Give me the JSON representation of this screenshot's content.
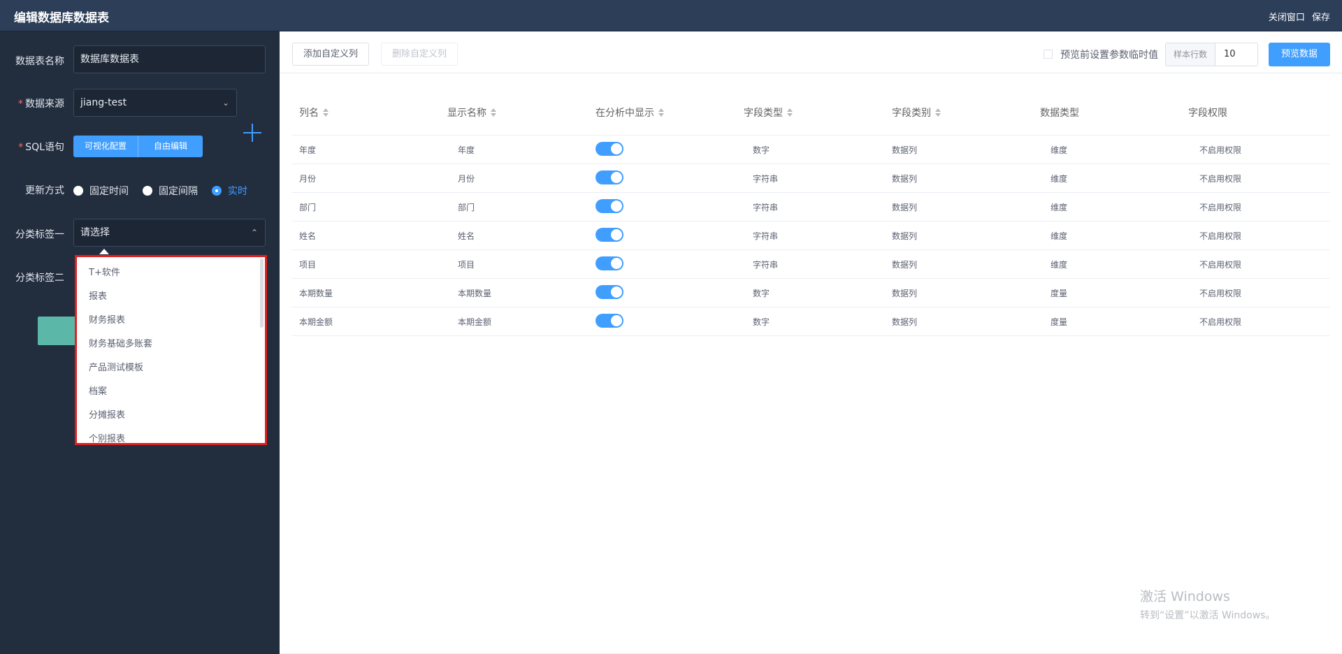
{
  "header": {
    "title": "编辑数据库数据表",
    "close_label": "关闭窗口",
    "save_label": "保存"
  },
  "form": {
    "table_name_label": "数据表名称",
    "table_name_value": "数据库数据表",
    "source_label": "数据来源",
    "source_value": "jiang-test",
    "sql_label": "SQL语句",
    "sql_modes": [
      "可视化配置",
      "自由编辑"
    ],
    "update_label": "更新方式",
    "update_options": [
      "固定时间",
      "固定间隔",
      "实时"
    ],
    "update_selected": "实时",
    "category1_label": "分类标签一",
    "category1_placeholder": "请选择",
    "category2_label": "分类标签二"
  },
  "dropdown": {
    "items": [
      "T+软件",
      "报表",
      "财务报表",
      "财务基础多账套",
      "产品测试模板",
      "档案",
      "分摊报表",
      "个别报表"
    ]
  },
  "toolbar": {
    "add_label": "添加自定义列",
    "delete_label": "删除自定义列",
    "preview_param_label": "预览前设置参数临时值",
    "sample_rows_label": "样本行数",
    "sample_rows_value": "10",
    "preview_label": "预览数据"
  },
  "table": {
    "headers": [
      "列名",
      "显示名称",
      "在分析中显示",
      "字段类型",
      "字段类别",
      "数据类型",
      "字段权限"
    ],
    "rows": [
      [
        "年度",
        "年度",
        "",
        "数字",
        "数据列",
        "维度",
        "不启用权限"
      ],
      [
        "月份",
        "月份",
        "",
        "字符串",
        "数据列",
        "维度",
        "不启用权限"
      ],
      [
        "部门",
        "部门",
        "",
        "字符串",
        "数据列",
        "维度",
        "不启用权限"
      ],
      [
        "姓名",
        "姓名",
        "",
        "字符串",
        "数据列",
        "维度",
        "不启用权限"
      ],
      [
        "项目",
        "项目",
        "",
        "字符串",
        "数据列",
        "维度",
        "不启用权限"
      ],
      [
        "本期数量",
        "本期数量",
        "",
        "数字",
        "数据列",
        "度量",
        "不启用权限"
      ],
      [
        "本期金额",
        "本期金额",
        "",
        "数字",
        "数据列",
        "度量",
        "不启用权限"
      ]
    ]
  },
  "watermark": {
    "line1": "激活 Windows",
    "line2": "转到“设置”以激活 Windows。"
  },
  "colors": {
    "header_bg": "#2c3e58",
    "sidebar_bg": "#222d3e",
    "primary": "#409eff",
    "dropdown_border": "#e0201f",
    "teal": "#5bb7a7"
  }
}
